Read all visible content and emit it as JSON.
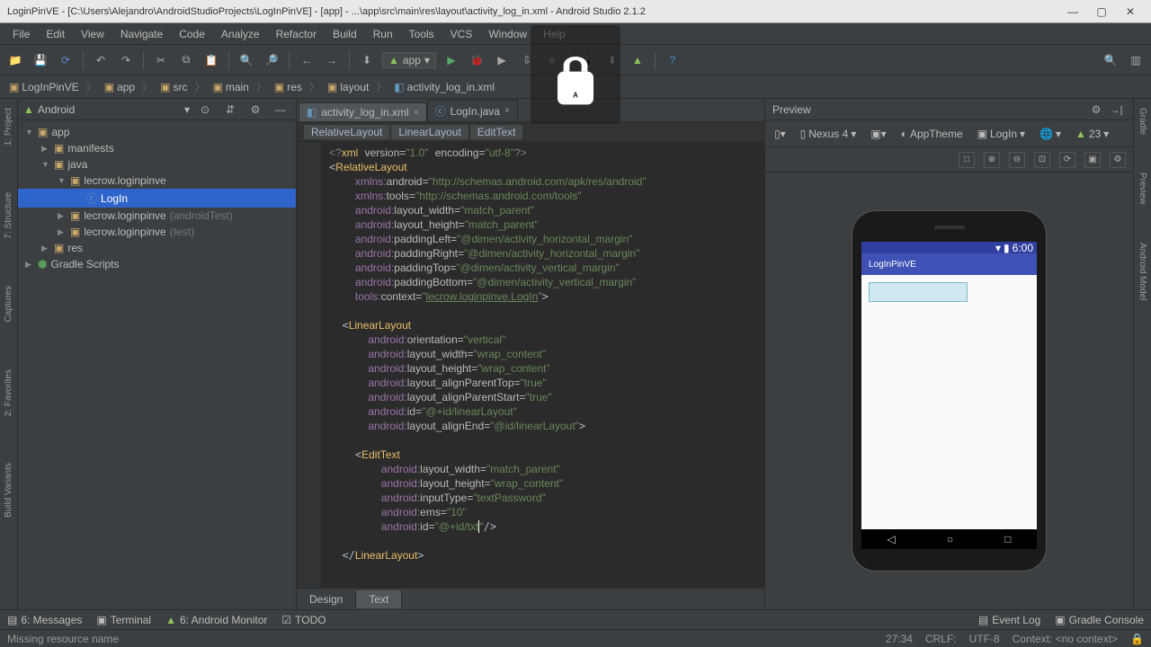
{
  "window": {
    "title": "LoginPinVE - [C:\\Users\\Alejandro\\AndroidStudioProjects\\LogInPinVE] - [app] - ...\\app\\src\\main\\res\\layout\\activity_log_in.xml - Android Studio 2.1.2"
  },
  "menu": [
    "File",
    "Edit",
    "View",
    "Navigate",
    "Code",
    "Analyze",
    "Refactor",
    "Build",
    "Run",
    "Tools",
    "VCS",
    "Window",
    "Help"
  ],
  "runconfig": "app",
  "nav": {
    "crumbs": [
      "LogInPinVE",
      "app",
      "src",
      "main",
      "res",
      "layout",
      "activity_log_in.xml"
    ]
  },
  "leftTabs": [
    "1: Project",
    "7: Structure",
    "2: Favorites",
    "Captures",
    "Build Variants"
  ],
  "rightTabs": [
    "Gradle",
    "Preview",
    "Android Model"
  ],
  "projectMode": "Android",
  "tree": {
    "app": "app",
    "manifests": "manifests",
    "java": "java",
    "pkg1": "lecrow.loginpinve",
    "login": "LogIn",
    "pkg2": "lecrow.loginpinve",
    "pkg2suffix": "(androidTest)",
    "pkg3": "lecrow.loginpinve",
    "pkg3suffix": "(test)",
    "res": "res",
    "gradle": "Gradle Scripts"
  },
  "editor": {
    "tabs": [
      {
        "name": "activity_log_in.xml"
      },
      {
        "name": "LogIn.java"
      }
    ],
    "breadcrumb": [
      "RelativeLayout",
      "LinearLayout",
      "EditText"
    ],
    "footerTabs": [
      "Design",
      "Text"
    ]
  },
  "preview": {
    "title": "Preview",
    "device": "Nexus 4",
    "theme": "AppTheme",
    "activity": "LogIn",
    "api": "23",
    "statusTime": "6:00",
    "appName": "LogInPinVE"
  },
  "bottom": {
    "messages": "6: Messages",
    "terminal": "Terminal",
    "monitor": "6: Android Monitor",
    "todo": "TODO",
    "eventlog": "Event Log",
    "console": "Gradle Console"
  },
  "status": {
    "msg": "Missing resource name",
    "pos": "27:34",
    "lineend": "CRLF:",
    "enc": "UTF-8",
    "context": "Context: <no context>"
  },
  "chart_data": null
}
